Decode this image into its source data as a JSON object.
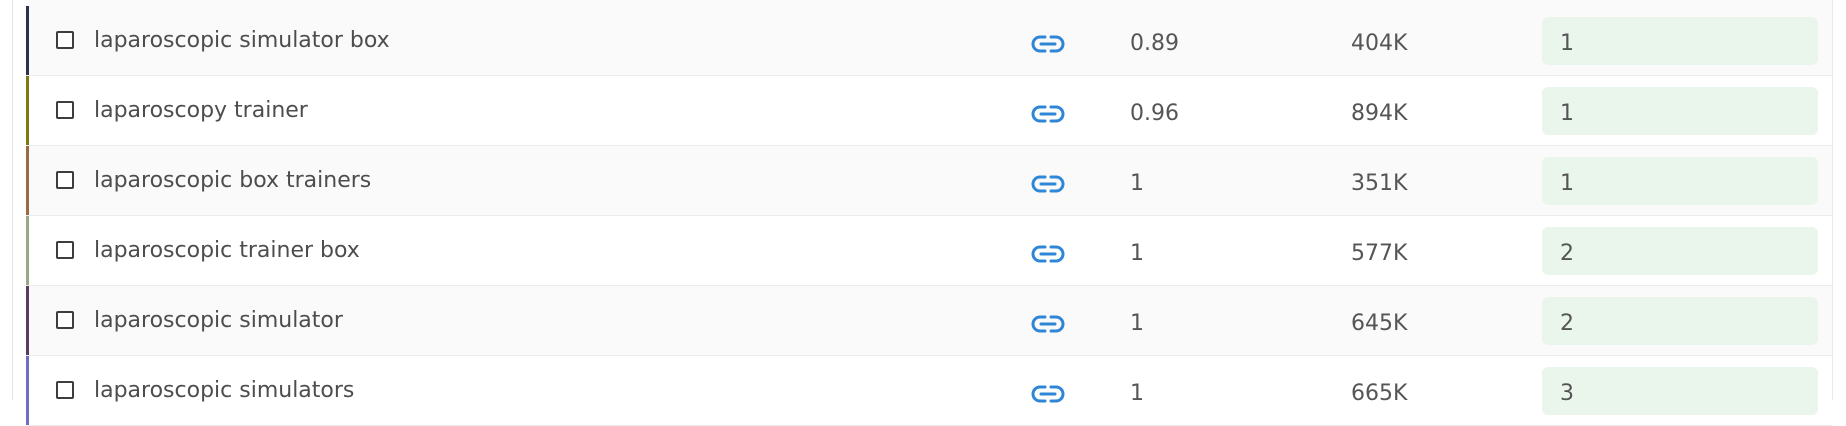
{
  "keyword_rows": [
    {
      "keyword": "laparoscopic simulator box",
      "kd": "0.89",
      "volume": "404K",
      "position": "1",
      "accent": "#2f3150"
    },
    {
      "keyword": "laparoscopy trainer",
      "kd": "0.96",
      "volume": "894K",
      "position": "1",
      "accent": "#7d7a12"
    },
    {
      "keyword": "laparoscopic box trainers",
      "kd": "1",
      "volume": "351K",
      "position": "1",
      "accent": "#9b6b45"
    },
    {
      "keyword": "laparoscopic trainer box",
      "kd": "1",
      "volume": "577K",
      "position": "2",
      "accent": "#9aa887"
    },
    {
      "keyword": "laparoscopic simulator",
      "kd": "1",
      "volume": "645K",
      "position": "2",
      "accent": "#5a3a60"
    },
    {
      "keyword": "laparoscopic simulators",
      "kd": "1",
      "volume": "665K",
      "position": "3",
      "accent": "#6e6fc4"
    }
  ],
  "icons": {
    "checkbox": "checkbox-icon",
    "link": "link-icon"
  },
  "colors": {
    "link_icon": "#2f86d6",
    "position_bg": "#eaf6ec"
  }
}
